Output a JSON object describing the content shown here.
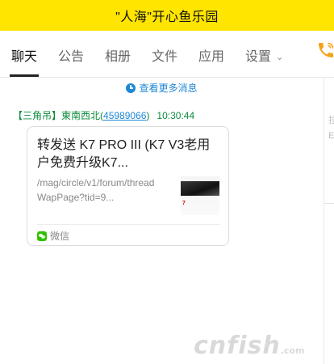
{
  "window": {
    "title": "\"人海\"开心鱼乐园"
  },
  "tabs": [
    {
      "label": "聊天",
      "active": true
    },
    {
      "label": "公告",
      "active": false
    },
    {
      "label": "相册",
      "active": false
    },
    {
      "label": "文件",
      "active": false
    },
    {
      "label": "应用",
      "active": false
    },
    {
      "label": "设置",
      "active": false
    }
  ],
  "header_icons": {
    "settings_chevron": "chevron-down-icon",
    "call": "phone-icon"
  },
  "chat": {
    "more_messages": "查看更多消息",
    "message": {
      "tag": "【三角吊】",
      "sender_name": "東南西北",
      "qq_open": "(",
      "qq_number": "45989066",
      "qq_close": ")",
      "time": "10:30:44",
      "card": {
        "title": "转发送 K7 PRO III (K7 V3老用户免费升级K7...",
        "url": "/mag/circle/v1/forum/threadWapPage?tid=9...",
        "source": "微信",
        "thumbnail_text": "7"
      }
    }
  },
  "right_panel": {
    "glyphs": [
      "拉",
      "E"
    ]
  },
  "watermark": {
    "text": "cnfish",
    "suffix": ".com"
  },
  "colors": {
    "title_bar": "#ffe500",
    "sender_green": "#0a8a3a",
    "link_blue": "#1e88d6",
    "call_orange": "#f5a21b"
  }
}
